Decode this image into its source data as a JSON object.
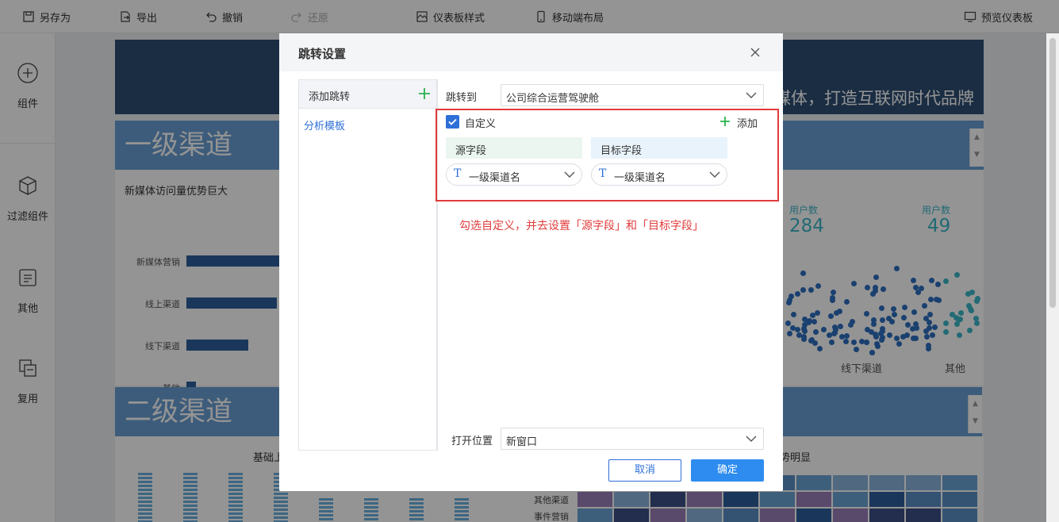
{
  "toolbar": {
    "save_as": "另存为",
    "export": "导出",
    "undo": "撤销",
    "redo": "还原",
    "dashboard_style": "仪表板样式",
    "mobile_layout": "移动端布局",
    "preview": "预览仪表板"
  },
  "rail": {
    "component": "组件",
    "filter_component": "过滤组件",
    "other": "其他",
    "reuse": "复用"
  },
  "dashboard": {
    "banner_text": "媒体，打造互联网时代品牌",
    "section1_title": "一级渠道",
    "section2_title": "二级渠道",
    "bar_chart_title": "新媒体访问量优势巨大",
    "bars": [
      {
        "label": "新媒体营销",
        "value": 100
      },
      {
        "label": "线上渠道",
        "value": 57
      },
      {
        "label": "线下渠道",
        "value": 39
      },
      {
        "label": "其他",
        "value": 6
      }
    ],
    "kpi1_label": "用户数",
    "kpi1_value": "284",
    "kpi2_label": "用户数",
    "kpi2_value": "49",
    "scatter_label1": "线下渠道",
    "scatter_label2": "其他",
    "bottom_title_left": "基础上",
    "bottom_title_right": "势明显",
    "heat_row1": "其他渠道",
    "heat_row2": "事件营销"
  },
  "dialog": {
    "title": "跳转设置",
    "add_jump": "添加跳转",
    "template_item": "分析模板",
    "jump_to_label": "跳转到",
    "jump_to_value": "公司综合运营驾驶舱",
    "custom_label": "自定义",
    "custom_checked": true,
    "add_label": "添加",
    "source_field_header": "源字段",
    "target_field_header": "目标字段",
    "source_field_value": "一级渠道名",
    "target_field_value": "一级渠道名",
    "hint": "勾选自定义，并去设置「源字段」和「目标字段」",
    "open_position_label": "打开位置",
    "open_position_value": "新窗口",
    "cancel": "取消",
    "ok": "确定"
  },
  "colors": {
    "accent": "#2e6fd8",
    "highlight_red": "#e03b3b",
    "add_green": "#2bb24c",
    "section_blue": "#6a9fd4"
  }
}
